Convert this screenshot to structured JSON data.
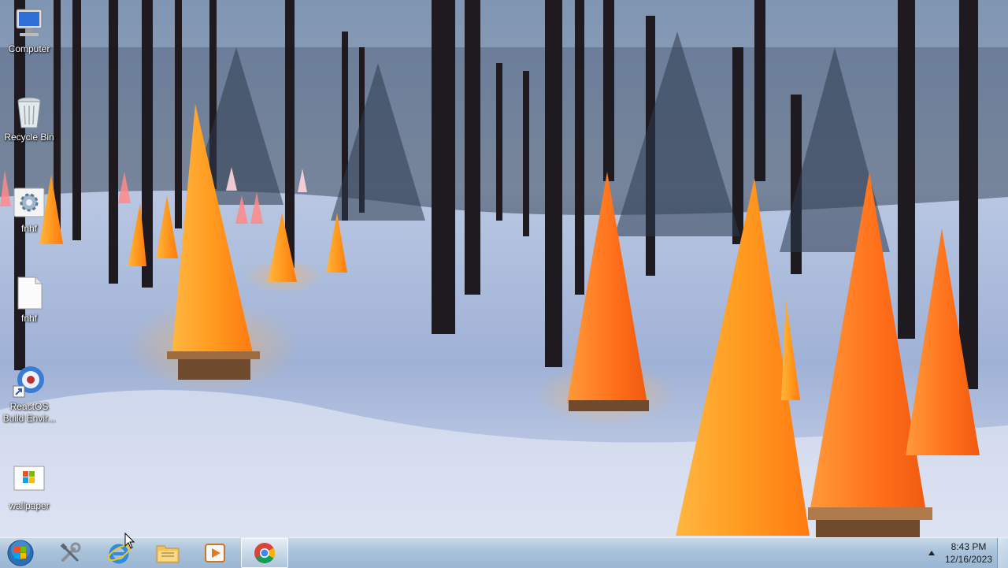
{
  "desktop": {
    "icons": [
      {
        "label": "Computer",
        "icon": "computer-icon"
      },
      {
        "label": "Recycle Bin",
        "icon": "recycle-bin-icon"
      },
      {
        "label": "fnhf",
        "icon": "program-gear-icon"
      },
      {
        "label": "fnhf",
        "icon": "text-file-icon"
      },
      {
        "label": "ReactOS\nBuild Envir...",
        "icon": "reactos-shortcut-icon"
      },
      {
        "label": "wallpaper",
        "icon": "windows-logo-image-icon"
      }
    ]
  },
  "taskbar": {
    "start": {
      "icon": "windows-start-orb-icon"
    },
    "items": [
      {
        "name": "tools",
        "icon": "tools-icon"
      },
      {
        "name": "internet-explorer",
        "icon": "internet-explorer-icon"
      },
      {
        "name": "file-explorer",
        "icon": "folder-icon"
      },
      {
        "name": "media-player",
        "icon": "media-player-icon"
      },
      {
        "name": "chrome",
        "icon": "chrome-icon",
        "active": true
      }
    ],
    "tray": {
      "icon": "show-hidden-icons-arrow"
    },
    "clock": {
      "time": "8:43 PM",
      "date": "12/16/2023"
    }
  },
  "colors": {
    "taskbar": "#a9c2db",
    "snow": "#c9d6ec",
    "cone_glow": "#ff9a1f"
  }
}
